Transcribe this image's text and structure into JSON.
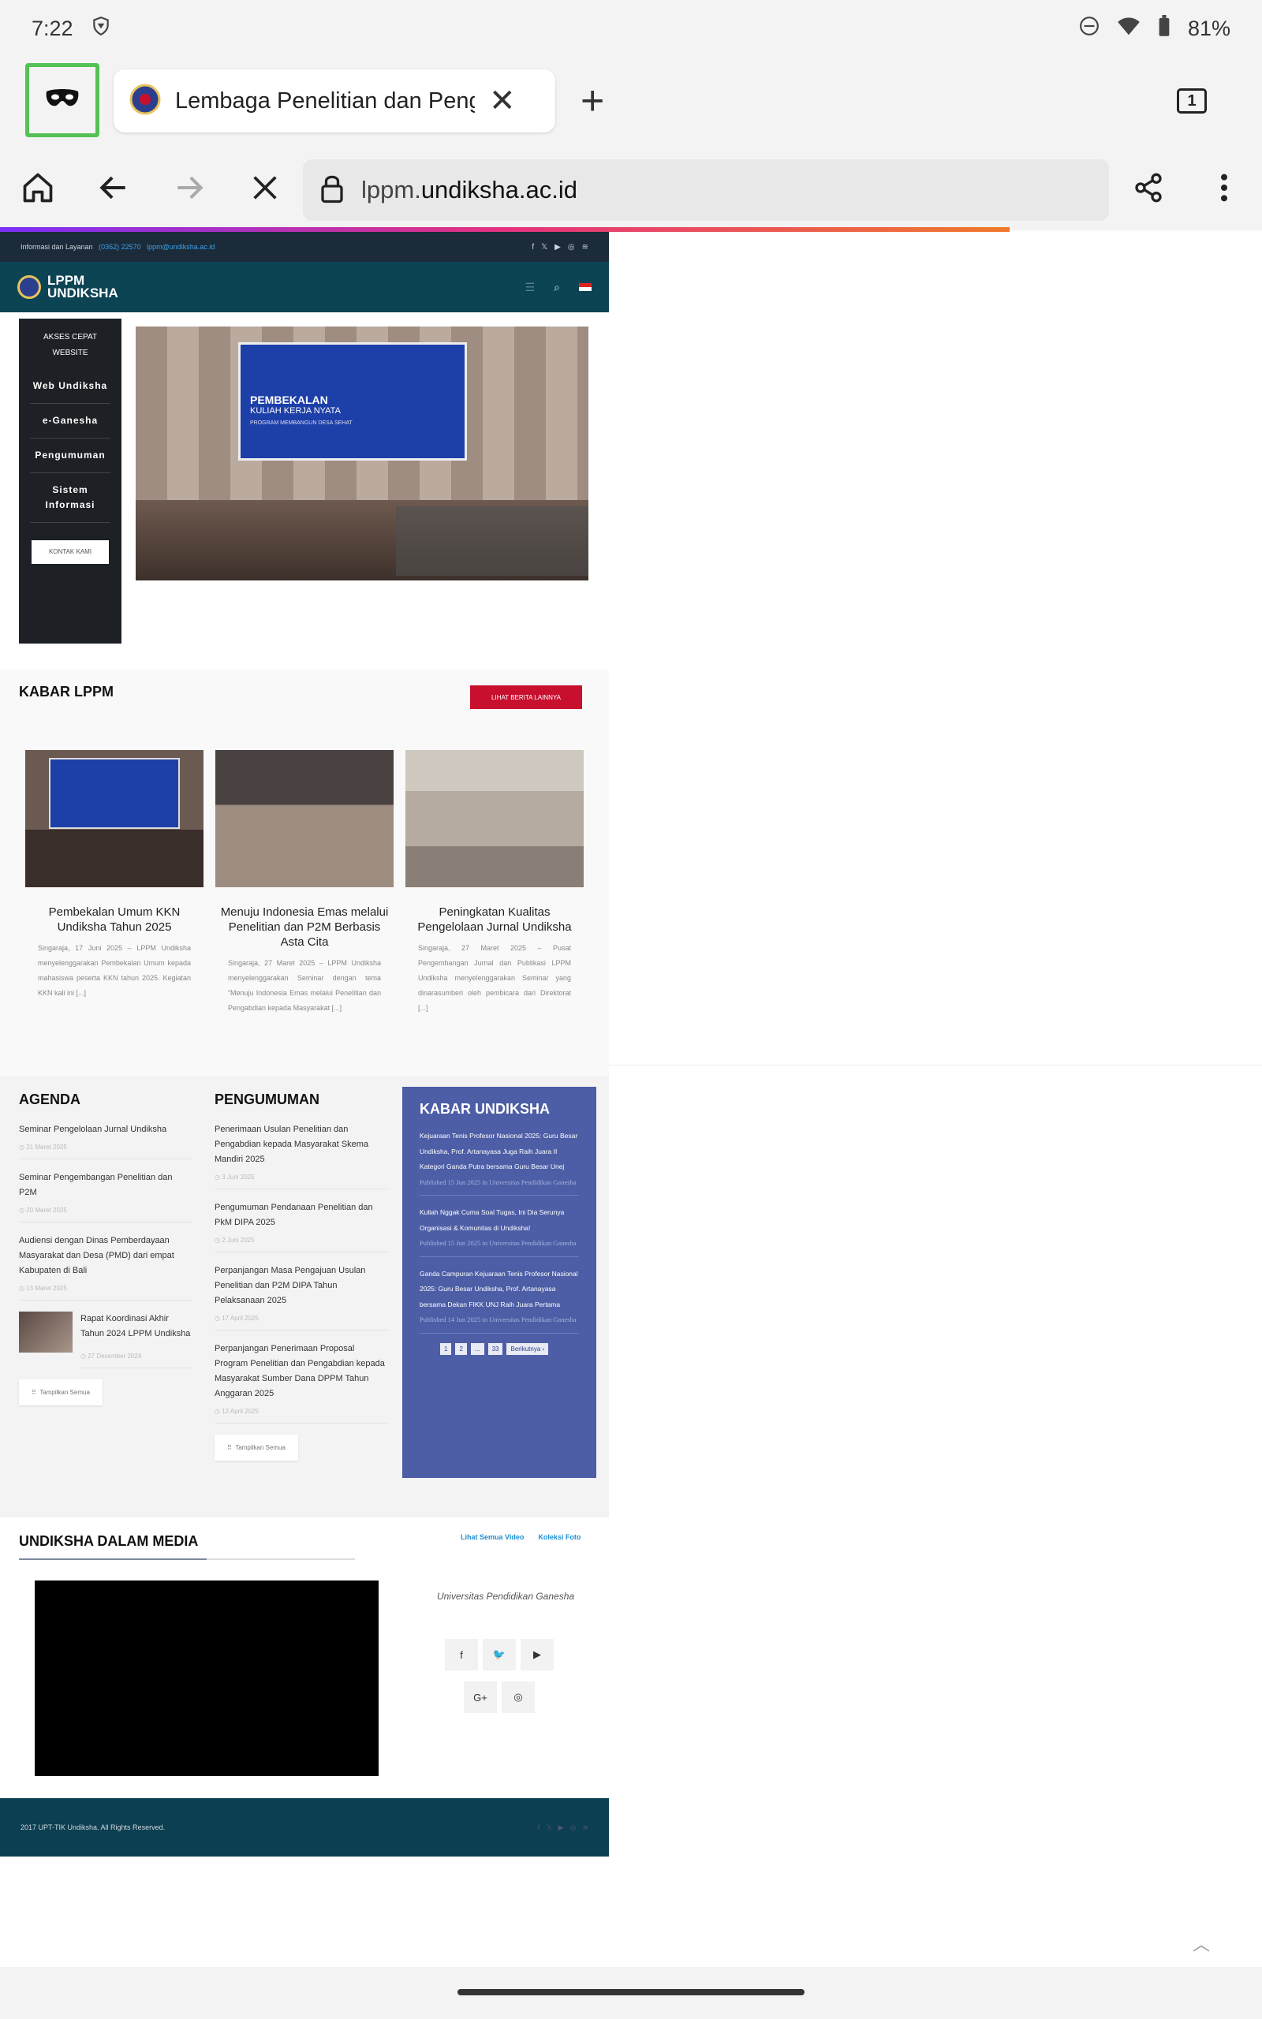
{
  "status": {
    "time": "7:22",
    "battery": "81%"
  },
  "tabs": {
    "title": "Lembaga Penelitian dan Peng",
    "count": "1"
  },
  "url": {
    "domain_prefix": "lppm.",
    "domain_main": "undiksha.ac.id"
  },
  "site": {
    "topbar_info": "Informasi dan Layanan",
    "topbar_phone": "(0362) 22570",
    "topbar_email": "lppm@undiksha.ac.id",
    "logo_line1": "LPPM",
    "logo_line2": "UNDIKSHA"
  },
  "quick_access": {
    "heading": "AKSES CEPAT WEBSITE",
    "items": [
      "Web Undiksha",
      "e-Ganesha",
      "Pengumuman",
      "Sistem Informasi"
    ],
    "contact": "KONTAK KAMI"
  },
  "hero": {
    "line1": "PEMBEKALAN",
    "line2": "KULIAH KERJA NYATA",
    "line3": "PROGRAM MEMBANGUN DESA SEHAT"
  },
  "kabar_lppm": {
    "title": "KABAR LPPM",
    "button": "LIHAT BERITA LAINNYA",
    "cards": [
      {
        "title": "Pembekalan Umum KKN Undiksha Tahun 2025",
        "desc": "Singaraja, 17 Juni 2025 – LPPM Undiksha menyelenggarakan Pembekalan Umum kepada mahasiswa peserta KKN tahun 2025. Kegiatan KKN kali ini [...]"
      },
      {
        "title": "Menuju Indonesia Emas melalui Penelitian dan P2M Berbasis Asta Cita",
        "desc": "Singaraja, 27 Maret 2025 – LPPM Undiksha menyelenggarakan Seminar dengan tema “Menuju Indonesia Emas melalui Penelitian dan Pengabdian kepada Masyarakat [...]"
      },
      {
        "title": "Peningkatan Kualitas Pengelolaan Jurnal Undiksha",
        "desc": "Singaraja, 27 Maret 2025 – Pusat Pengembangan Jurnal dan Publikasi LPPM Undiksha menyelenggarakan Seminar yang dinarasumberi oleh pembicara dari Direktorat [...]"
      }
    ]
  },
  "agenda": {
    "title": "AGENDA",
    "items": [
      {
        "text": "Seminar Pengelolaan Jurnal Undiksha",
        "date": "21 Maret 2025"
      },
      {
        "text": "Seminar Pengembangan Penelitian dan P2M",
        "date": "20 Maret 2025"
      },
      {
        "text": "Audiensi dengan Dinas Pemberdayaan Masyarakat dan Desa (PMD) dari empat Kabupaten di Bali",
        "date": "13 Maret 2025"
      },
      {
        "text": "Rapat Koordinasi Akhir Tahun 2024 LPPM Undiksha",
        "date": "27 Desember 2024"
      }
    ],
    "show_all": "Tampilkan Semua"
  },
  "pengumuman": {
    "title": "PENGUMUMAN",
    "items": [
      {
        "text": "Penerimaan Usulan Penelitian dan Pengabdian kepada Masyarakat Skema Mandiri 2025",
        "date": "3 Juni 2025"
      },
      {
        "text": "Pengumuman Pendanaan Penelitian dan PkM DIPA 2025",
        "date": "2 Juni 2025"
      },
      {
        "text": "Perpanjangan Masa Pengajuan Usulan Penelitian dan P2M DIPA Tahun Pelaksanaan 2025",
        "date": "17 April 2025"
      },
      {
        "text": "Perpanjangan Penerimaan Proposal Program Penelitian dan Pengabdian kepada Masyarakat Sumber Dana DPPM Tahun Anggaran 2025",
        "date": "12 April 2025"
      }
    ],
    "show_all": "Tampilkan Semua"
  },
  "kabar_undiksha": {
    "title": "KABAR UNDIKSHA",
    "items": [
      {
        "text": "Kejuaraan Tenis Profesor Nasional 2025: Guru Besar Undiksha, Prof. Artanayasa Juga Raih Juara II Kategori Ganda Putra bersama Guru Besar Unej",
        "meta": "Published 15 Jun 2025 in Universitas Pendidikan Ganesha"
      },
      {
        "text": "Kuliah Nggak Cuma Soal Tugas, Ini Dia Serunya Organisasi & Komunitas di Undiksha!",
        "meta": "Published 15 Jun 2025 in Universitas Pendidikan Ganesha"
      },
      {
        "text": "Ganda Campuran Kejuaraan Tenis Profesor Nasional 2025: Guru Besar Undiksha, Prof. Artanayasa bersama Dekan FIKK UNJ Raih Juara Pertama",
        "meta": "Published 14 Jun 2025 in Universitas Pendidikan Ganesha"
      }
    ],
    "pages": [
      "1",
      "2",
      "...",
      "33",
      "Berikutnya ›"
    ]
  },
  "media": {
    "title": "UNDIKSHA DALAM MEDIA",
    "link_video": "Lihat Semua Video",
    "link_foto": "Koleksi Foto",
    "univ_name": "Universitas Pendidikan Ganesha"
  },
  "footer": {
    "copyright": "2017 UPT-TIK Undiksha. All Rights Reserved."
  }
}
